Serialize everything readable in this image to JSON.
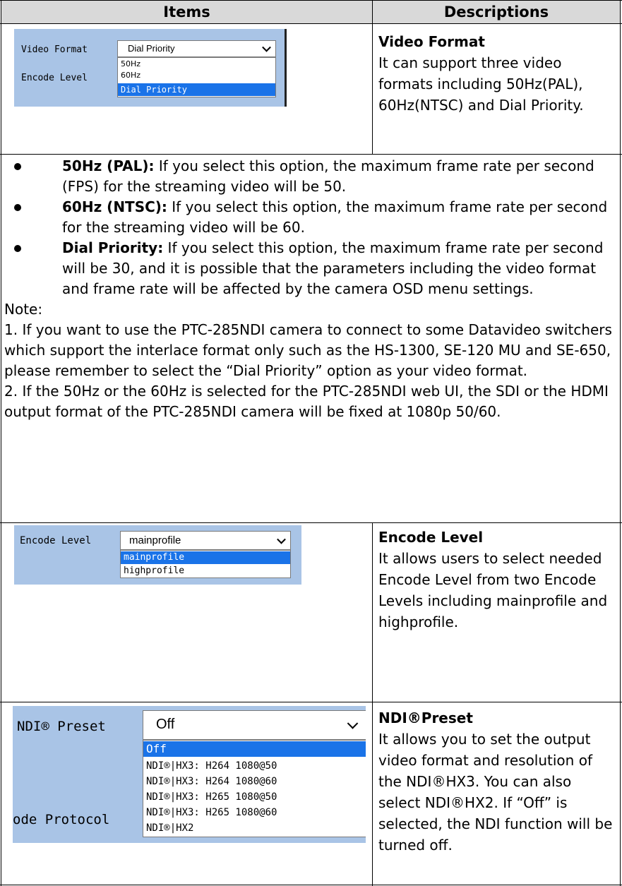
{
  "header": {
    "items": "Items",
    "descriptions": "Descriptions"
  },
  "video_format": {
    "label": "Video Format",
    "other_label": "Encode Level",
    "selected": "Dial Priority",
    "options": [
      "50Hz",
      "60Hz",
      "Dial Priority"
    ],
    "title": "Video Format",
    "description": "It can support three video formats including 50Hz(PAL), 60Hz(NTSC) and Dial Priority."
  },
  "notes": {
    "bullets": [
      {
        "term": "50Hz (PAL):",
        "text": " If you select this option, the maximum frame rate per second (FPS) for the streaming video will be 50."
      },
      {
        "term": "60Hz (NTSC):",
        "text": " If you select this option, the maximum frame rate per second for the streaming video will be 60."
      },
      {
        "term": "Dial Priority:",
        "text": " If you select this option, the maximum frame rate per second will be 30, and it is possible that the parameters including the video format and frame rate will be affected by the camera OSD menu settings."
      }
    ],
    "note_label": "Note:",
    "note_1": "1. If you want to use the PTC-285NDI camera to connect to some Datavideo switchers which support the interlace format only such as the HS-1300, SE-120 MU and SE-650, please remember to select the “Dial Priority” option as your video format.",
    "note_2": "2. If the 50Hz or the 60Hz is selected for the PTC-285NDI web UI, the SDI or the HDMI output format of the PTC-285NDI camera will be fixed at 1080p 50/60."
  },
  "encode_level": {
    "label": "Encode Level",
    "selected": "mainprofile",
    "options": [
      "mainprofile",
      "highprofile"
    ],
    "title": "Encode Level",
    "description": "It allows users to select needed Encode Level from two Encode Levels including mainprofile and highprofile."
  },
  "ndi_preset": {
    "label": "NDI® Preset",
    "other_label": "ode Protocol",
    "selected": "Off",
    "options": [
      "Off",
      "NDI®|HX3: H264 1080@50",
      "NDI®|HX3: H264 1080@60",
      "NDI®|HX3: H265 1080@50",
      "NDI®|HX3: H265 1080@60",
      "NDI®|HX2"
    ],
    "title": "NDI®Preset",
    "description": "It allows you to set the output video format and resolution of the NDI®HX3. You can also select NDI®HX2.   If “Off” is selected, the NDI function will be turned off."
  },
  "colors": {
    "header_bg": "#d9d9d9",
    "panel_bg": "#a9c4e6",
    "selected_option": "#1a73e8"
  }
}
